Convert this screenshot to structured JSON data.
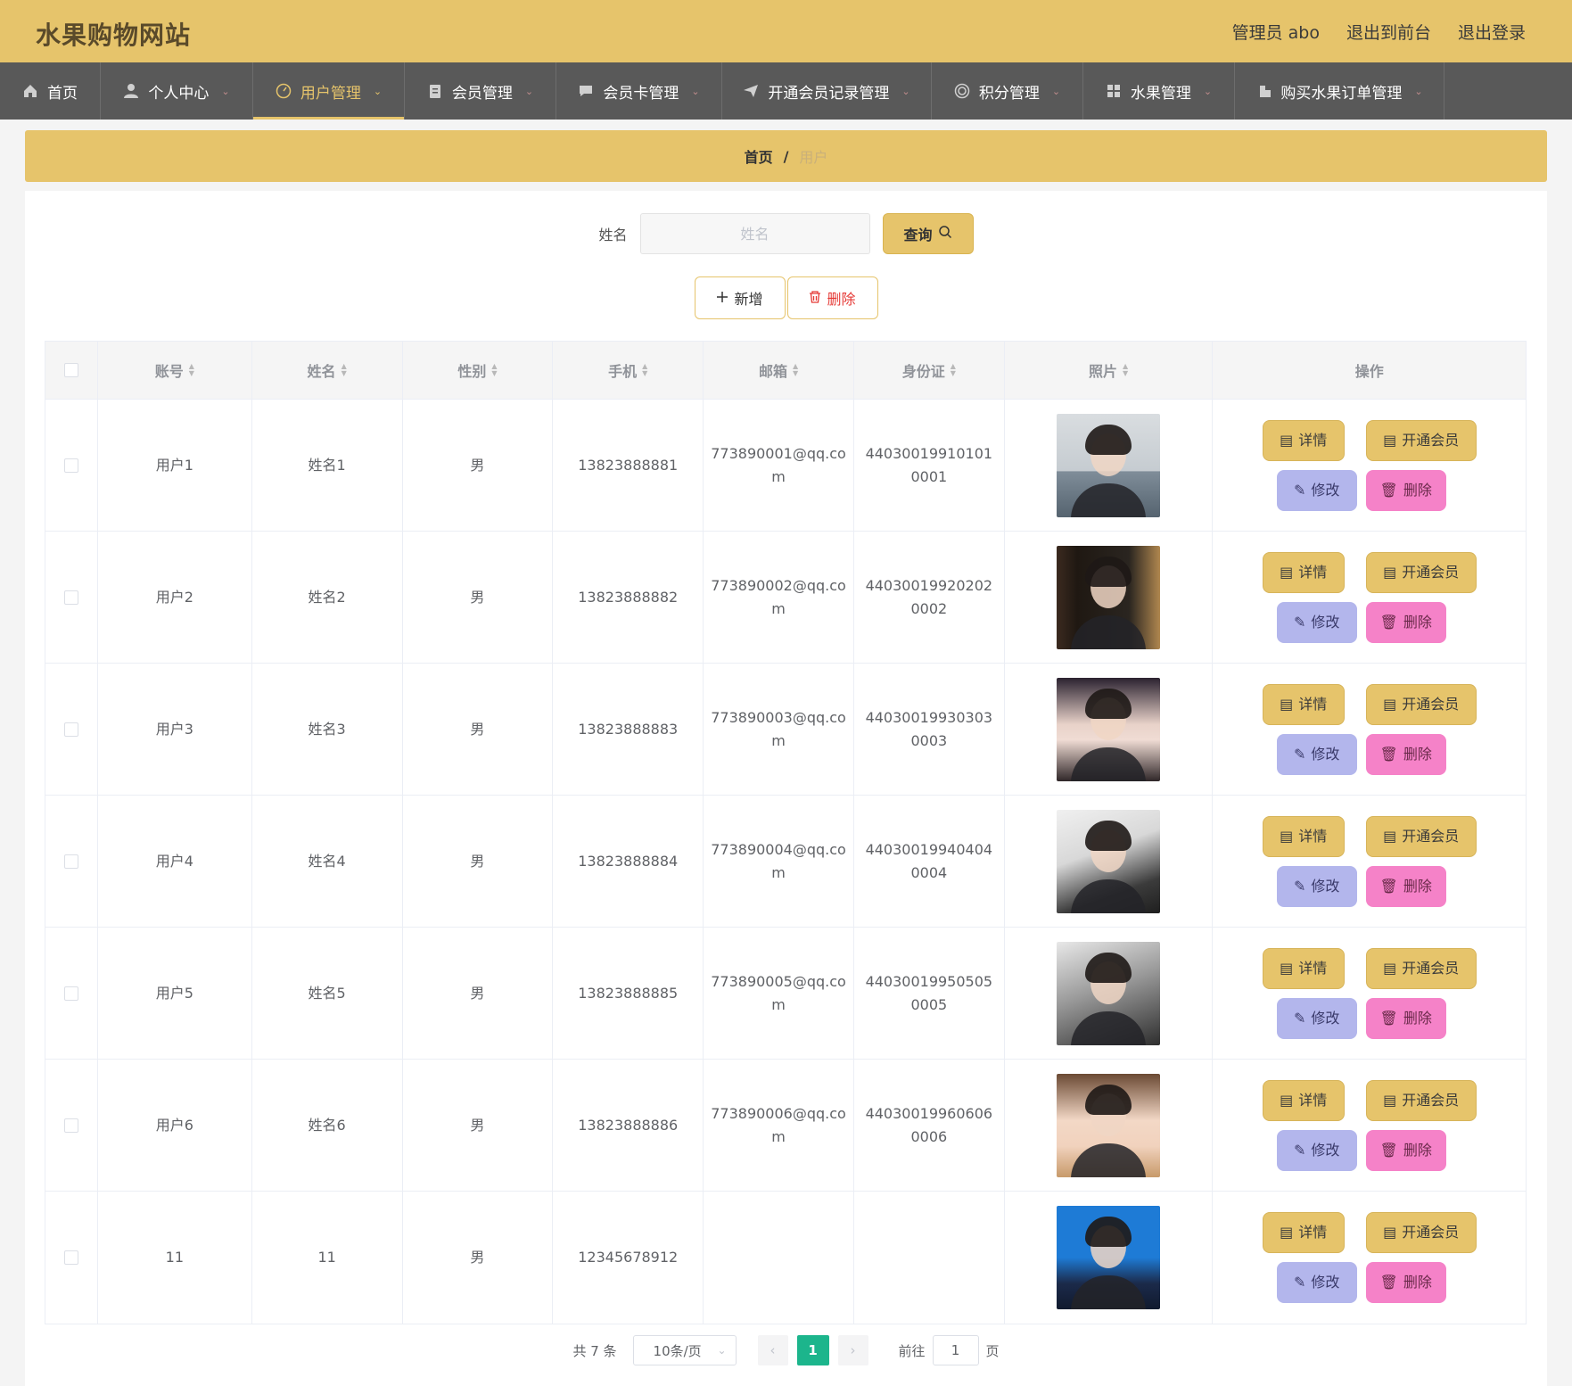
{
  "header": {
    "site_title": "水果购物网站",
    "admin_label": "管理员 abo",
    "to_front": "退出到前台",
    "logout": "退出登录"
  },
  "nav": {
    "items": [
      {
        "label": "首页",
        "icon": "home-icon",
        "has_caret": false
      },
      {
        "label": "个人中心",
        "icon": "user-icon",
        "has_caret": true
      },
      {
        "label": "用户管理",
        "icon": "dashboard-icon",
        "has_caret": true,
        "active": true
      },
      {
        "label": "会员管理",
        "icon": "clipboard-icon",
        "has_caret": true
      },
      {
        "label": "会员卡管理",
        "icon": "chat-icon",
        "has_caret": true
      },
      {
        "label": "开通会员记录管理",
        "icon": "send-icon",
        "has_caret": true
      },
      {
        "label": "积分管理",
        "icon": "target-icon",
        "has_caret": true
      },
      {
        "label": "水果管理",
        "icon": "grid-icon",
        "has_caret": true
      },
      {
        "label": "购买水果订单管理",
        "icon": "cart-icon",
        "has_caret": true
      }
    ]
  },
  "breadcrumb": {
    "home": "首页",
    "separator": "/",
    "current": "用户"
  },
  "search": {
    "label": "姓名",
    "placeholder": "姓名",
    "value": "",
    "query_button": "查询"
  },
  "actions": {
    "add": "新增",
    "delete": "删除"
  },
  "table": {
    "columns": [
      "账号",
      "姓名",
      "性别",
      "手机",
      "邮箱",
      "身份证",
      "照片",
      "操作"
    ],
    "rows": [
      {
        "account": "用户1",
        "name": "姓名1",
        "gender": "男",
        "phone": "13823888881",
        "email": "773890001@qq.com",
        "id_card": "440300199101010001",
        "photo": "photo-woman-seaside"
      },
      {
        "account": "用户2",
        "name": "姓名2",
        "gender": "男",
        "phone": "13823888882",
        "email": "773890002@qq.com",
        "id_card": "440300199202020002",
        "photo": "photo-man-selfie"
      },
      {
        "account": "用户3",
        "name": "姓名3",
        "gender": "男",
        "phone": "13823888883",
        "email": "773890003@qq.com",
        "id_card": "440300199303030003",
        "photo": "photo-woman-portrait"
      },
      {
        "account": "用户4",
        "name": "姓名4",
        "gender": "男",
        "phone": "13823888884",
        "email": "773890004@qq.com",
        "id_card": "440300199404040004",
        "photo": "photo-woman-cap"
      },
      {
        "account": "用户5",
        "name": "姓名5",
        "gender": "男",
        "phone": "13823888885",
        "email": "773890005@qq.com",
        "id_card": "440300199505050005",
        "photo": "photo-man-bw"
      },
      {
        "account": "用户6",
        "name": "姓名6",
        "gender": "男",
        "phone": "13823888886",
        "email": "773890006@qq.com",
        "id_card": "440300199606060006",
        "photo": "photo-woman-wink"
      },
      {
        "account": "11",
        "name": "11",
        "gender": "男",
        "phone": "12345678912",
        "email": "",
        "id_card": "",
        "photo": "photo-man-suit"
      }
    ],
    "row_actions": {
      "detail": "详情",
      "vip": "开通会员",
      "edit": "修改",
      "delete": "删除"
    }
  },
  "pagination": {
    "total": "共 7 条",
    "page_size": "10条/页",
    "current_page": "1",
    "goto_label": "前往",
    "goto_value": "1",
    "page_unit": "页"
  },
  "colors": {
    "accent": "#e6c46b",
    "nav_bg": "#595959",
    "edit": "#b3b6ec",
    "delete": "#f582c8",
    "page_active": "#1cb58c"
  }
}
